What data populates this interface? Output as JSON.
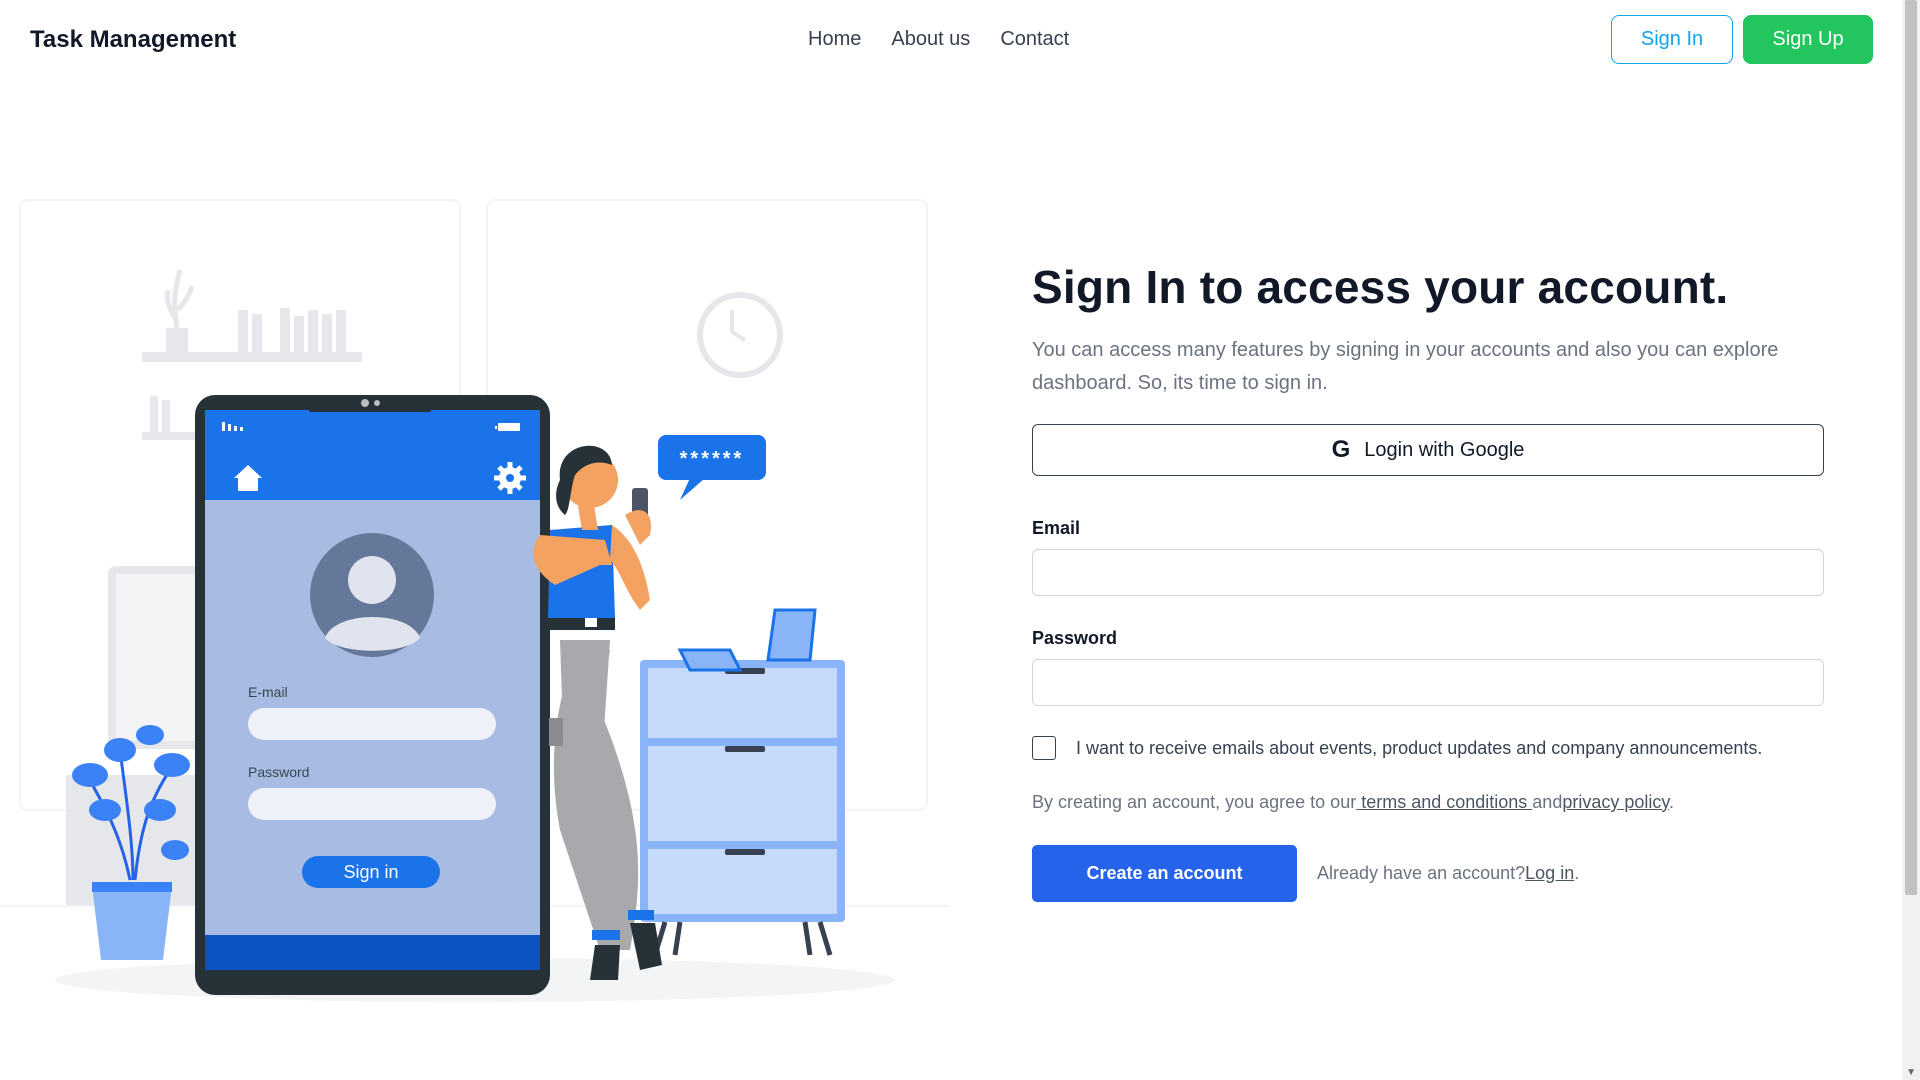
{
  "navbar": {
    "brand": "Task Management",
    "links": [
      "Home",
      "About us",
      "Contact"
    ],
    "sign_in": "Sign In",
    "sign_up": "Sign Up"
  },
  "illustration": {
    "phone_email_label": "E-mail",
    "phone_password_label": "Password",
    "phone_sign_in": "Sign in",
    "bubble_text": "******"
  },
  "form": {
    "heading": "Sign In to access your account.",
    "subtext": "You can access many features by signing in your accounts and also you can explore dashboard. So, its time to sign in.",
    "google_label": "Login with Google",
    "email_label": "Email",
    "password_label": "Password",
    "checkbox_label": "I want to receive emails about events, product updates and company announcements.",
    "terms_prefix": "By creating an account, you agree to our",
    "terms_link": " terms and conditions ",
    "terms_and": "and",
    "privacy_link": "privacy policy",
    "terms_suffix": ".",
    "create_button": "Create an account",
    "already_text": "Already have an account?",
    "login_link": "Log in",
    "login_suffix": "."
  },
  "colors": {
    "primary_blue": "#2563eb",
    "sign_up_green": "#22c55e",
    "sign_in_outline": "#0ea5e9",
    "illustration_blue": "#1a73e8"
  }
}
